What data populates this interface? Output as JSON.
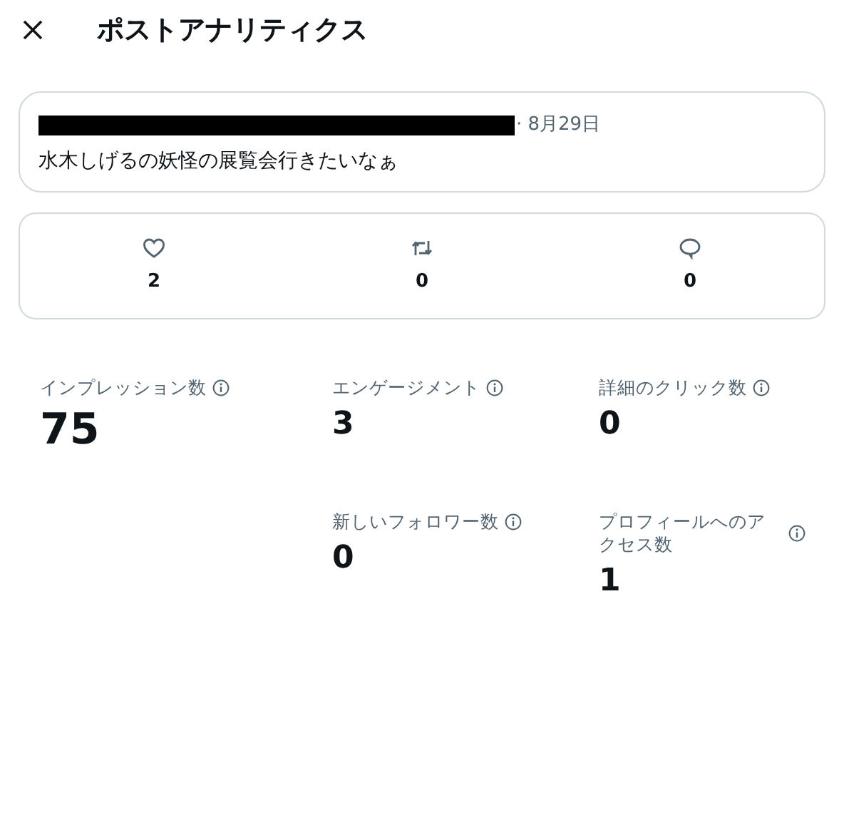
{
  "header": {
    "title": "ポストアナリティクス"
  },
  "post": {
    "date": "· 8月29日",
    "text": "水木しげるの妖怪の展覧会行きたいなぁ"
  },
  "engagement": [
    {
      "kind": "like",
      "count": "2"
    },
    {
      "kind": "repost",
      "count": "0"
    },
    {
      "kind": "reply",
      "count": "0"
    }
  ],
  "metrics": [
    {
      "label": "インプレッション数",
      "value": "75",
      "kind": "primary"
    },
    {
      "label": "エンゲージメント",
      "value": "3",
      "kind": "secondary"
    },
    {
      "label": "詳細のクリック数",
      "value": "0",
      "kind": "secondary"
    },
    {
      "label": "新しいフォロワー数",
      "value": "0",
      "kind": "secondary"
    },
    {
      "label": "プロフィールへのアクセス数",
      "value": "1",
      "kind": "secondary"
    }
  ]
}
